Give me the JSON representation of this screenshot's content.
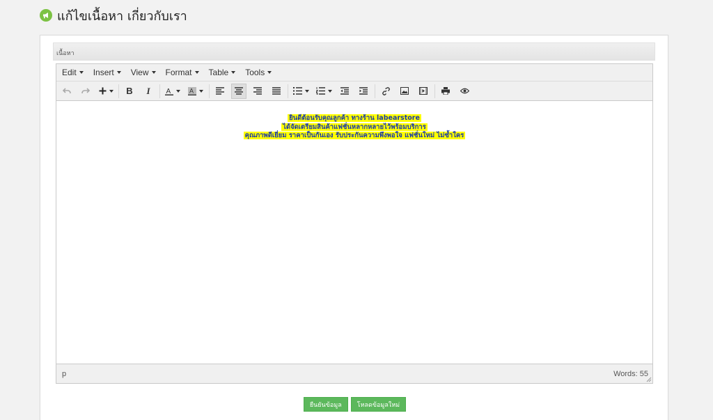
{
  "page": {
    "title": "แก้ไขเนื้อหา เกี่ยวกับเรา"
  },
  "section": {
    "label": "เนื้อหา"
  },
  "editor": {
    "menus": [
      "Edit",
      "Insert",
      "View",
      "Format",
      "Table",
      "Tools"
    ],
    "content_lines": [
      "ยินดีต้อนรับคุณลูกค้า ทางร้าน labearstore",
      "ได้จัดเตรียมสินค้าแฟชั่นหลากหลายไว้พร้อมบริการ",
      "คุณภาพดีเยี่ยม ราคาเป็นกันเอง รับประกันความพึงพอใจ แฟชั่นใหม่ ไม่ซ้ำใคร"
    ],
    "text_color": "#1a3aa8",
    "highlight_color": "#ffff00",
    "status_path": "p",
    "word_count": "Words: 55"
  },
  "actions": {
    "confirm_label": "ยืนยันข้อมูล",
    "reload_label": "โหลดข้อมูลใหม่"
  },
  "colors": {
    "accent": "#5cb85c",
    "icon": "#7cc243"
  }
}
